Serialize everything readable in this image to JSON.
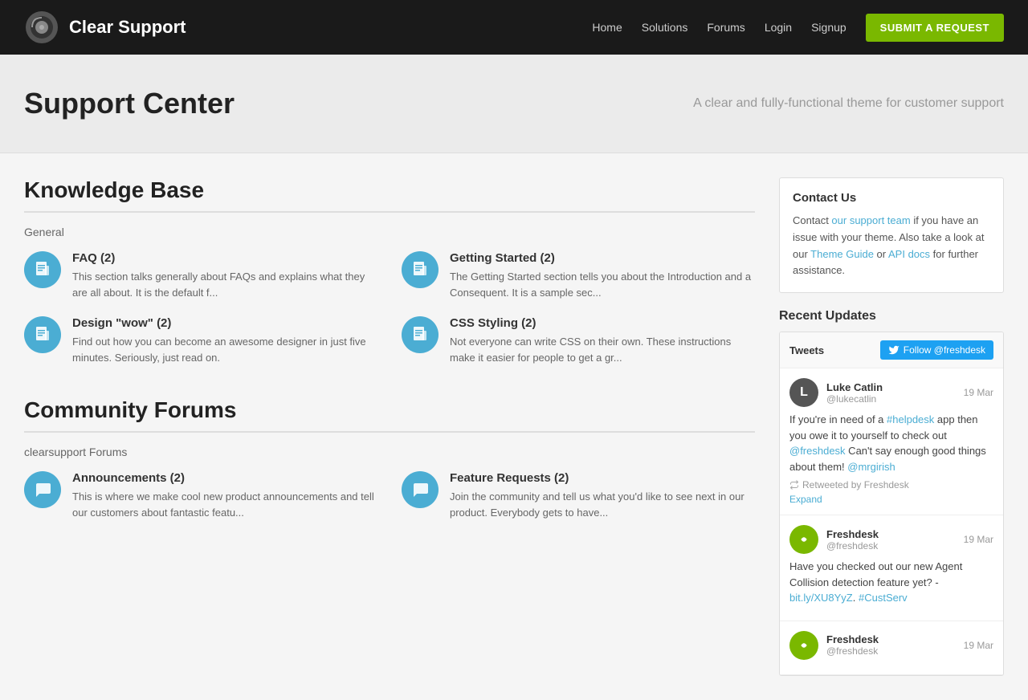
{
  "header": {
    "logo_text": "Clear Support",
    "nav": {
      "home": "Home",
      "solutions": "Solutions",
      "forums": "Forums",
      "login": "Login",
      "signup": "Signup",
      "submit": "SUBMIT A REQUEST"
    }
  },
  "hero": {
    "title": "Support Center",
    "subtitle": "A clear and fully-functional theme for customer support"
  },
  "knowledge_base": {
    "section_title": "Knowledge Base",
    "subsection_title": "General",
    "items": [
      {
        "title": "FAQ (2)",
        "desc": "This section talks generally about FAQs and explains what they are all about. It is the default f..."
      },
      {
        "title": "Getting Started (2)",
        "desc": "The Getting Started section tells you about the Introduction and a Consequent. It is a sample sec..."
      },
      {
        "title": "Design \"wow\" (2)",
        "desc": "Find out how you can become an awesome designer in just five minutes. Seriously, just read on."
      },
      {
        "title": "CSS Styling (2)",
        "desc": "Not everyone can write CSS on their own. These instructions make it easier for people to get a gr..."
      }
    ]
  },
  "community_forums": {
    "section_title": "Community Forums",
    "subsection_title": "clearsupport Forums",
    "items": [
      {
        "title": "Announcements (2)",
        "desc": "This is where we make cool new product announcements and tell our customers about fantastic featu..."
      },
      {
        "title": "Feature Requests (2)",
        "desc": "Join the community and tell us what you'd like to see next in our product. Everybody gets to have..."
      }
    ]
  },
  "sidebar": {
    "contact_us": {
      "title": "Contact Us",
      "text_before": "Contact ",
      "support_link": "our support team",
      "text_mid": " if you have an issue with your theme. Also take a look at our ",
      "theme_link": "Theme Guide",
      "text_or": " or ",
      "api_link": "API docs",
      "text_after": " for further assistance."
    },
    "recent_updates": {
      "title": "Recent Updates",
      "tweets_label": "Tweets",
      "follow_label": "Follow @freshdesk",
      "tweets": [
        {
          "name": "Luke Catlin",
          "handle": "@lukecatlin",
          "date": "19 Mar",
          "text": "If you're in need of a #helpdesk app then you owe it to yourself to check out @freshdesk Can't say enough good things about them! @mrgirish",
          "retweet": "Retweeted by Freshdesk",
          "expand": "Expand",
          "avatar_type": "luke"
        },
        {
          "name": "Freshdesk",
          "handle": "@freshdesk",
          "date": "19 Mar",
          "text": "Have you checked out our new Agent Collision detection feature yet? - bit.ly/XU8YyZ. #CustServ",
          "retweet": "",
          "expand": "",
          "avatar_type": "freshdesk"
        },
        {
          "name": "Freshdesk",
          "handle": "@freshdesk",
          "date": "19 Mar",
          "text": "",
          "retweet": "",
          "expand": "",
          "avatar_type": "freshdesk"
        }
      ]
    }
  }
}
